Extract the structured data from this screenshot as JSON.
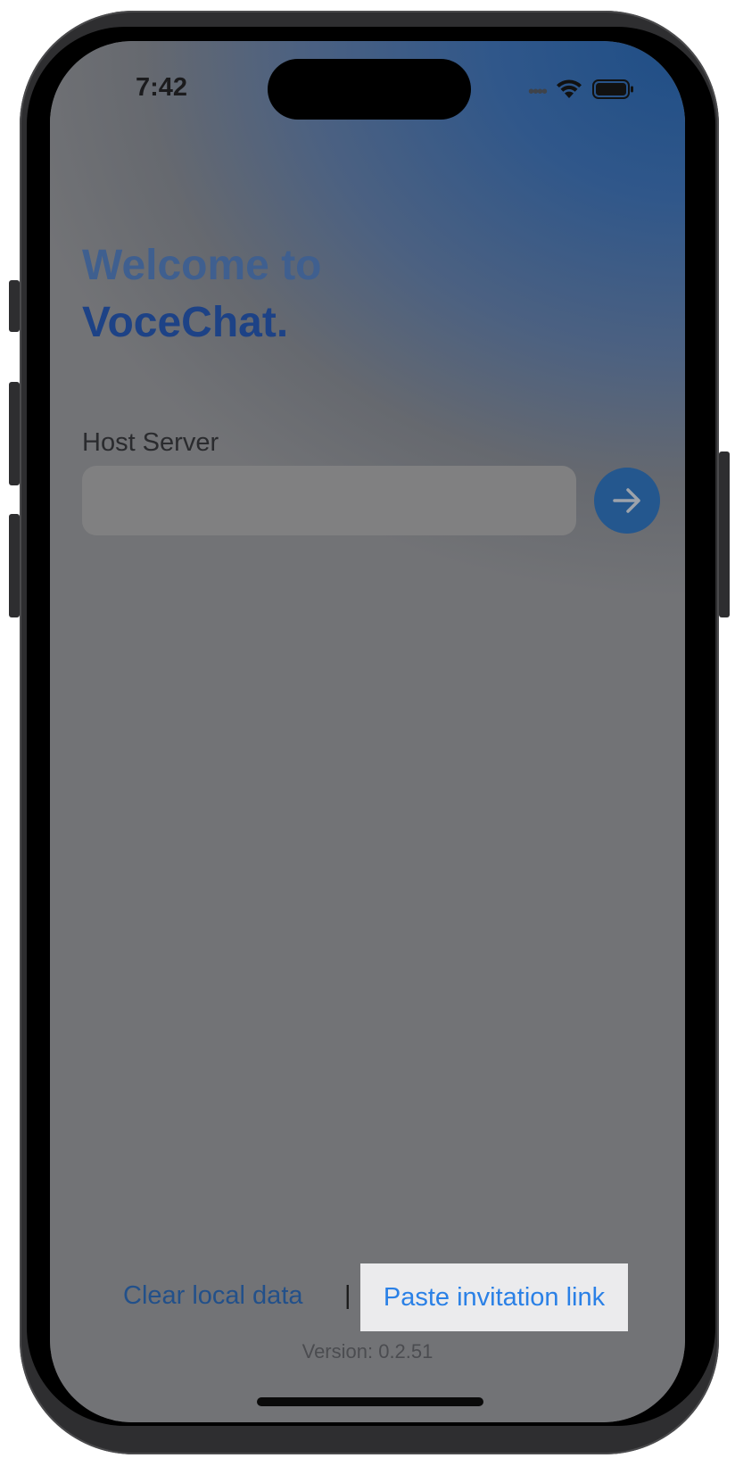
{
  "status_bar": {
    "time": "7:42",
    "icons": [
      "cellular-icon",
      "wifi-icon",
      "battery-icon"
    ]
  },
  "welcome": {
    "line1": "Welcome to",
    "line2": "VoceChat."
  },
  "host_server": {
    "label": "Host Server",
    "value": "",
    "placeholder": ""
  },
  "go_button": {
    "icon": "arrow-right-icon"
  },
  "footer": {
    "clear_label": "Clear local data",
    "separator": "|",
    "paste_label": "Paste invitation link",
    "version": "Version: 0.2.51"
  },
  "colors": {
    "accent": "#24578e",
    "link_highlight": "#2a80e6",
    "brand": "#1d4286"
  }
}
